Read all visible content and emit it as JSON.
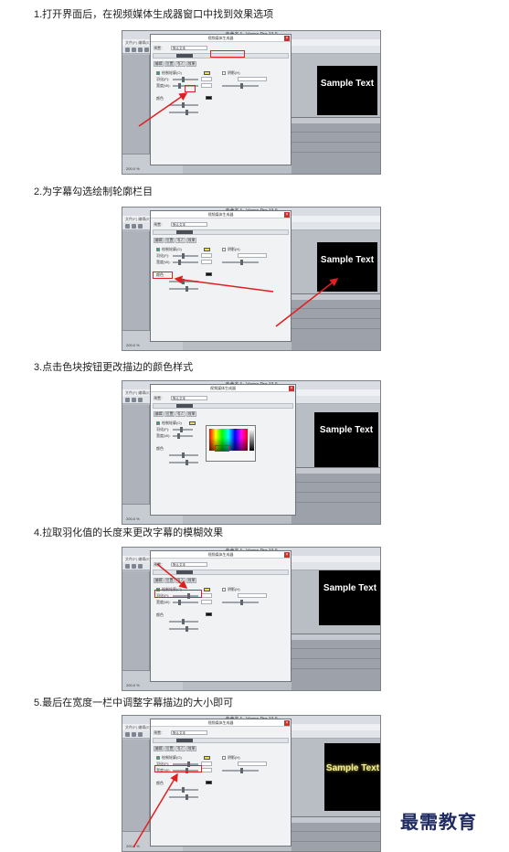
{
  "steps": [
    {
      "text": "1.打开界面后，在视频媒体生成器窗口中找到效果选项",
      "dialog_title": "视频媒体生成器",
      "preview_text": "Sample Text"
    },
    {
      "text": "2.为字幕勾选绘制轮廓栏目",
      "dialog_title": "视频媒体生成器",
      "preview_text": "Sample Text"
    },
    {
      "text": "3.点击色块按钮更改描边的颜色样式",
      "dialog_title": "视频媒体生成器",
      "preview_text": "Sample Text"
    },
    {
      "text": "4.拉取羽化值的长度来更改字幕的模糊效果",
      "dialog_title": "视频媒体生成器",
      "preview_text": "Sample Text"
    },
    {
      "text": "5.最后在宽度一栏中调整字幕描边的大小即可",
      "dialog_title": "视频媒体生成器",
      "preview_text": "Sample Text"
    }
  ],
  "app": {
    "window_title": "未命名 * - Vegas Pro 13.0",
    "menu": "文件(F)  编辑(E)  视图(V)  插入(I)  工具(T)  选项(O)  帮助(H)",
    "zoom": "200.0 %"
  },
  "dialog": {
    "preset_label": "预置：",
    "preset_value": "默认文本",
    "tabs": [
      "编辑",
      "位置",
      "描边",
      "效果"
    ],
    "outline_label": "绘制轮廓(O)",
    "feather_label": "羽化(F):",
    "width_label": "宽度(W):",
    "shadow_label": "阴影(H)",
    "color_label": "颜色"
  },
  "colors": {
    "highlight": "#e02020",
    "watermark": "#1f2b62",
    "preview_bg": "#000000"
  },
  "watermark": "最需教育"
}
